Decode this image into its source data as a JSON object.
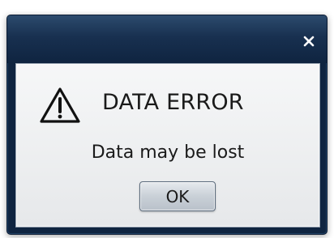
{
  "dialog": {
    "close_icon": "close-icon",
    "warning_icon": "warning-triangle-icon",
    "title": "DATA ERROR",
    "message": "Data may be lost",
    "ok_label": "OK"
  },
  "colors": {
    "titlebar": "#183050",
    "content_background": "#eceef0",
    "button": "#c9d0d7",
    "text": "#1a1a1a"
  }
}
